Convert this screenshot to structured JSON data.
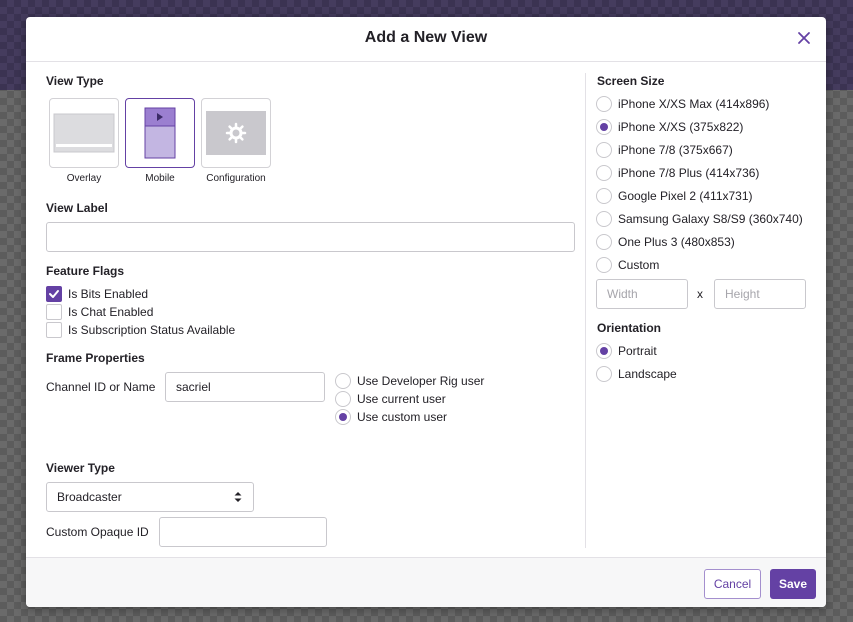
{
  "modal": {
    "title": "Add a New View"
  },
  "view_type": {
    "label": "View Type",
    "options": [
      {
        "label": "Overlay",
        "selected": false
      },
      {
        "label": "Mobile",
        "selected": true
      },
      {
        "label": "Configuration",
        "selected": false
      }
    ]
  },
  "view_label": {
    "label": "View Label",
    "value": "",
    "placeholder": ""
  },
  "feature_flags": {
    "label": "Feature Flags",
    "items": [
      {
        "label": "Is Bits Enabled",
        "checked": true
      },
      {
        "label": "Is Chat Enabled",
        "checked": false
      },
      {
        "label": "Is Subscription Status Available",
        "checked": false
      }
    ]
  },
  "frame_properties": {
    "label": "Frame Properties",
    "channel_label": "Channel ID or Name",
    "channel_value": "sacriel",
    "user_options": [
      {
        "label": "Use Developer Rig user",
        "checked": false
      },
      {
        "label": "Use current user",
        "checked": false
      },
      {
        "label": "Use custom user",
        "checked": true
      }
    ]
  },
  "viewer_type": {
    "label": "Viewer Type",
    "selected": "Broadcaster",
    "opaque_label": "Custom Opaque ID",
    "opaque_value": ""
  },
  "screen_size": {
    "label": "Screen Size",
    "options": [
      {
        "label": "iPhone X/XS Max (414x896)",
        "checked": false
      },
      {
        "label": "iPhone X/XS (375x822)",
        "checked": true
      },
      {
        "label": "iPhone 7/8 (375x667)",
        "checked": false
      },
      {
        "label": "iPhone 7/8 Plus (414x736)",
        "checked": false
      },
      {
        "label": "Google Pixel 2 (411x731)",
        "checked": false
      },
      {
        "label": "Samsung Galaxy S8/S9 (360x740)",
        "checked": false
      },
      {
        "label": "One Plus 3 (480x853)",
        "checked": false
      },
      {
        "label": "Custom",
        "checked": false
      }
    ],
    "width_placeholder": "Width",
    "height_placeholder": "Height",
    "separator": "x"
  },
  "orientation": {
    "label": "Orientation",
    "options": [
      {
        "label": "Portrait",
        "checked": true
      },
      {
        "label": "Landscape",
        "checked": false
      }
    ]
  },
  "footer": {
    "cancel_label": "Cancel",
    "save_label": "Save"
  },
  "colors": {
    "accent": "#6441a4",
    "accent_light": "#c3b6e2",
    "backdrop": "#5c5c5c"
  }
}
